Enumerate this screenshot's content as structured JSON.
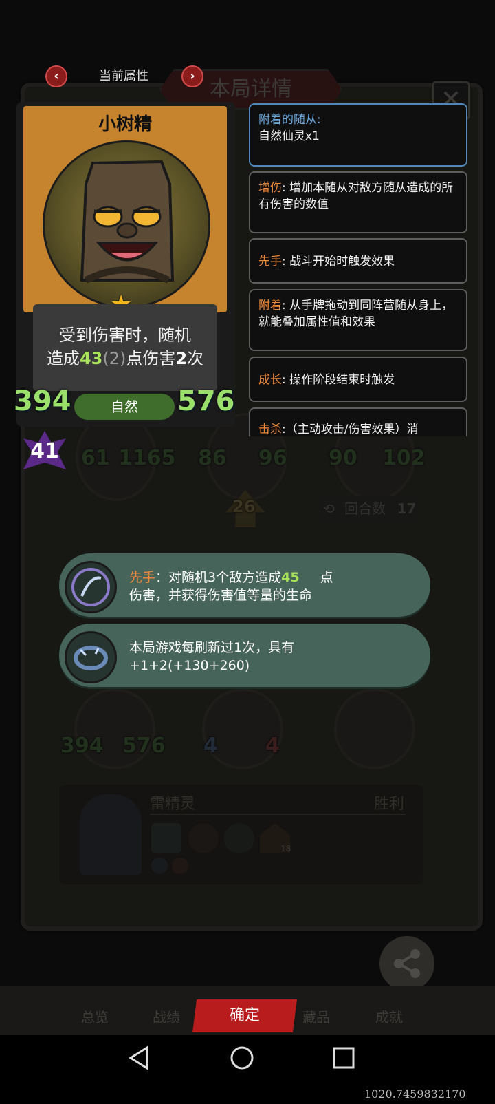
{
  "header": {
    "prev_icon": "chevron-left-icon",
    "next_icon": "chevron-right-icon",
    "title": "当前属性",
    "background_banner": "本局详情"
  },
  "card": {
    "name": "小树精",
    "desc_line1": "受到伤害时，随机",
    "desc_line2_pre": "造成",
    "desc_value": "43",
    "desc_bonus": "(2)",
    "desc_line2_mid": "点伤害",
    "desc_times": "2",
    "desc_line2_post": "次",
    "attack": "394",
    "health": "576",
    "type": "自然",
    "level": "41"
  },
  "keywords": [
    {
      "key": "附着的随从:",
      "text": "自然仙灵x1",
      "selected": true
    },
    {
      "key": "增伤",
      "text": ": 增加本随从对敌方随从造成的所有伤害的数值"
    },
    {
      "key": "先手",
      "text": ": 战斗开始时触发效果"
    },
    {
      "key": "附着",
      "text": ": 从手牌拖动到同阵营随从身上，就能叠加属性值和效果"
    },
    {
      "key": "成长",
      "text": ": 操作阶段结束时触发"
    },
    {
      "key": "击杀",
      "text": ":（主动攻击/伤害效果）消"
    }
  ],
  "board": {
    "row1": [
      "61",
      "1165",
      "86",
      "96",
      "90",
      "102"
    ],
    "center_badge": "26",
    "round_label": "回合数",
    "round_value": "17",
    "row3": [
      "394",
      "576",
      "4",
      "4"
    ],
    "enemy_name": "雷精灵",
    "result": "胜利",
    "house_count": "18"
  },
  "bubbles": [
    {
      "icon": "spirit-skill-icon",
      "key": "先手",
      "text_pre": "：对随机3个敌方造成",
      "num": "45",
      "text_mid": "点",
      "line2": "伤害，并获得伤害值等量的生命"
    },
    {
      "icon": "ring-skill-icon",
      "line1": "本局游戏每刷新过1次，具有",
      "line2": "+1+2(+130+260)"
    }
  ],
  "share": {
    "label": "分享",
    "icon": "share-icon"
  },
  "tabs": [
    "总览",
    "战绩",
    "藏品",
    "成就"
  ],
  "confirm_label": "确定",
  "overlay_text": "1020.7459832170"
}
